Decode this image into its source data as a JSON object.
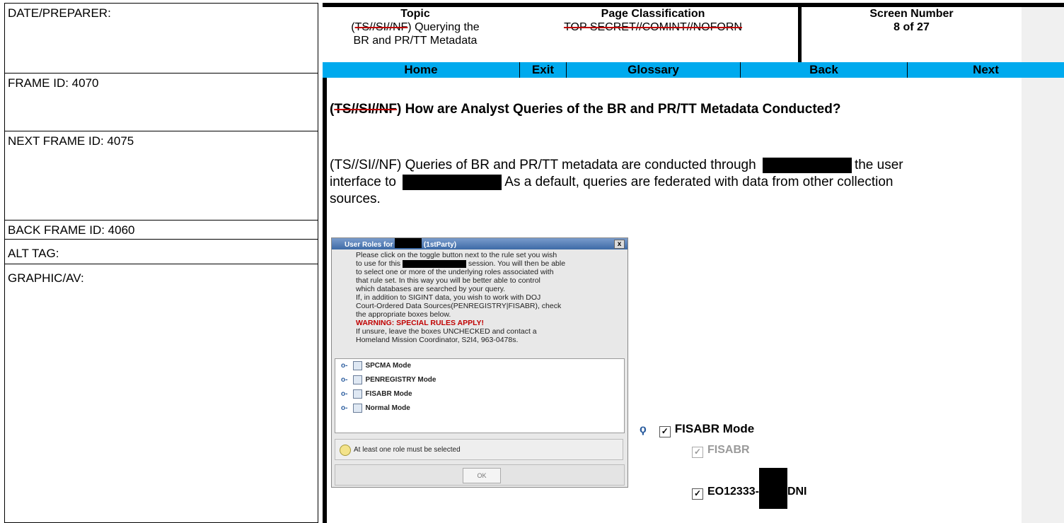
{
  "left_column": {
    "date_preparer": "DATE/PREPARER:",
    "frame_id": "FRAME ID: 4070",
    "next_frame_id": "NEXT FRAME ID: 4075",
    "back_frame_id": "BACK FRAME ID: 4060",
    "alt_tag": "ALT TAG:",
    "graphic_av": "GRAPHIC/AV:"
  },
  "header": {
    "topic_title": "Topic",
    "topic_marking": "TS//SI//NF",
    "topic_text_1": " Querying the",
    "topic_text_2": "BR and PR/TT Metadata",
    "classification_title": "Page Classification",
    "classification_value": "TOP SECRET//COMINT//NOFORN",
    "screen_title": "Screen Number",
    "screen_value": "8 of 27"
  },
  "nav": {
    "home": "Home",
    "exit": "Exit",
    "glossary": "Glossary",
    "back": "Back",
    "next": "Next"
  },
  "content": {
    "heading_marking": "TS//SI//NF",
    "heading_text": " How are Analyst Queries of the BR and PR/TT Metadata Conducted?",
    "para_1": "(TS//SI//NF) Queries of BR and PR/TT metadata are conducted through",
    "para_2": "the user",
    "para_3": "interface to",
    "para_4": "As a default, queries are federated with data from other collection",
    "para_5": "sources."
  },
  "dialog": {
    "title_prefix": "User Roles for",
    "title_suffix": "(1stParty)",
    "close": "x",
    "line1": "Please click on the toggle button next to the rule set you wish",
    "line2a": "to use for this",
    "line2b": "session.  You will then be able",
    "line3": "to select one or more of the underlying roles associated with",
    "line4": "that rule set.  In this way you will be better able to control",
    "line5": "which databases are searched by your query.",
    "line6": "If, in addition to SIGINT data, you wish to work with DOJ",
    "line7": "Court-Ordered Data Sources(PENREGISTRY|FISABR), check",
    "line8": "the appropriate boxes below.",
    "warning": "WARNING:  SPECIAL RULES APPLY!",
    "line9": "If unsure, leave the boxes UNCHECKED and contact a",
    "line10": "Homeland Mission Coordinator, S2I4, 963-0478s.",
    "modes": [
      "SPCMA Mode",
      "PENREGISTRY Mode",
      "FISABR Mode",
      "Normal Mode"
    ],
    "hint": "At least one role must be selected",
    "ok": "OK"
  },
  "tree": {
    "parent": "FISABR Mode",
    "child1": "FISABR",
    "child2a": "EO12333-",
    "child2b": "DNI"
  }
}
